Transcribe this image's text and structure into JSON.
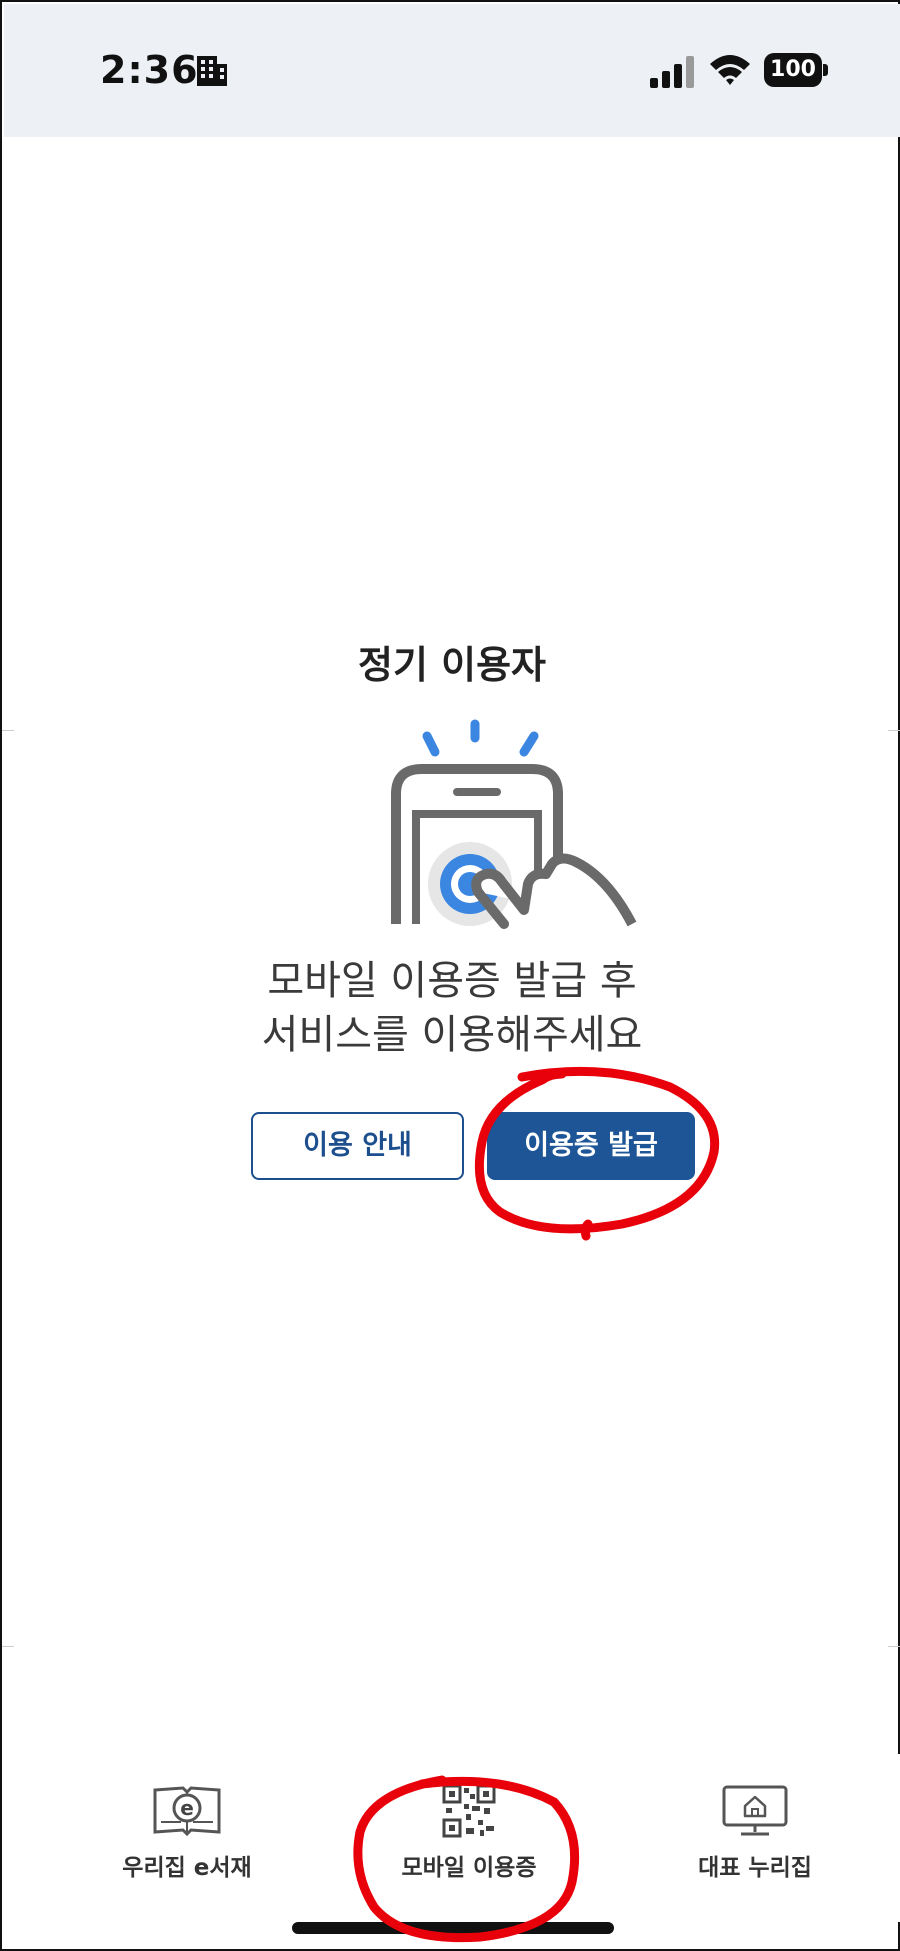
{
  "status_bar": {
    "time": "2:36",
    "battery": "100",
    "icons": [
      "building-icon",
      "signal-icon",
      "wifi-icon",
      "battery-icon"
    ]
  },
  "main": {
    "title": "정기 이용자",
    "message_line1": "모바일 이용증 발급 후",
    "message_line2": "서비스를 이용해주세요",
    "guide_button": "이용 안내",
    "issue_button": "이용증 발급",
    "illustration": "phone-tap-icon"
  },
  "bottom_nav": {
    "items": [
      {
        "label": "우리집 e서재",
        "icon": "ebook-icon"
      },
      {
        "label": "모바일 이용증",
        "icon": "qr-code-icon"
      },
      {
        "label": "대표 누리집",
        "icon": "monitor-home-icon"
      }
    ]
  },
  "colors": {
    "primary": "#1d5597",
    "status_bar_bg": "#edf1f6",
    "illustration_blue": "#3a86e0",
    "illustration_gray": "#6a6a6a",
    "annotation_red": "#e8000a"
  }
}
